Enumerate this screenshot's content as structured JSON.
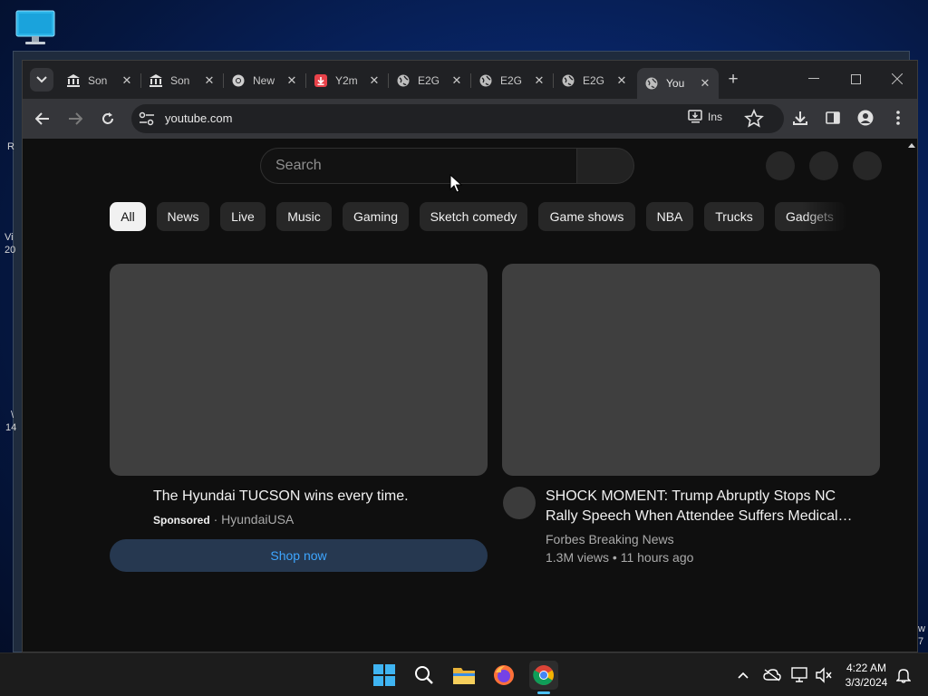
{
  "desktop": {
    "fragments": [
      "R",
      "Vi",
      "20",
      "\\",
      "14",
      "w",
      "7"
    ]
  },
  "browser": {
    "tabs": [
      {
        "title": "Son",
        "favicon": "institution-icon",
        "close": "✕"
      },
      {
        "title": "Son",
        "favicon": "institution-icon",
        "close": "✕"
      },
      {
        "title": "New",
        "favicon": "chrome-icon",
        "close": "✕"
      },
      {
        "title": "Y2m",
        "favicon": "download-red-icon",
        "close": "✕"
      },
      {
        "title": "E2G",
        "favicon": "globe-icon",
        "close": "✕"
      },
      {
        "title": "E2G",
        "favicon": "globe-icon",
        "close": "✕"
      },
      {
        "title": "E2G",
        "favicon": "globe-icon",
        "close": "✕"
      },
      {
        "title": "You",
        "favicon": "globe-icon",
        "close": "✕",
        "active": true
      }
    ],
    "new_tab": "+",
    "address": "youtube.com",
    "install_label": "Ins"
  },
  "youtube": {
    "search_placeholder": "Search",
    "chips": [
      "All",
      "News",
      "Live",
      "Music",
      "Gaming",
      "Sketch comedy",
      "Game shows",
      "NBA",
      "Trucks",
      "Gadgets"
    ],
    "videos": [
      {
        "title": "The Hyundai TUCSON wins every time.",
        "sponsored": "Sponsored",
        "channel": "· HyundaiUSA",
        "cta": "Shop now"
      },
      {
        "title_line1": "SHOCK MOMENT: Trump Abruptly Stops NC",
        "title_line2": "Rally Speech When Attendee Suffers Medical…",
        "channel": "Forbes Breaking News",
        "stats": "1.3M views • 11 hours ago"
      }
    ]
  },
  "taskbar": {
    "time": "4:22 AM",
    "date": "3/3/2024"
  },
  "colors": {
    "accent_link": "#3ea6ff",
    "chip_selected_bg": "#f1f1f1",
    "page_bg": "#0f0f0f"
  }
}
